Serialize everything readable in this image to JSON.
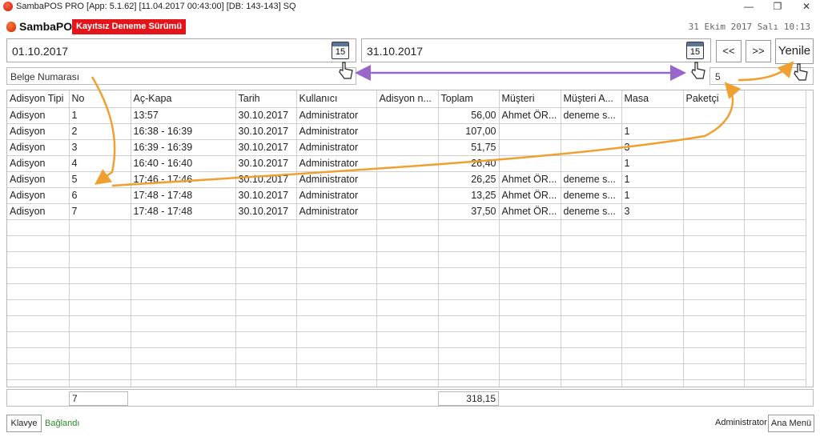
{
  "window": {
    "title": "SambaPOS PRO [App: 5.1.62] [11.04.2017 00:43:00] [DB: 143-143] SQ",
    "minimize": "—",
    "restore": "❐",
    "close": "✕"
  },
  "brand": {
    "name": "SambaPOS",
    "badge": "Kayıtsız Deneme Sürümü"
  },
  "clock": "31 Ekim 2017 Salı 10:13",
  "filters": {
    "start_date": "01.10.2017",
    "end_date": "31.10.2017",
    "calendar_day": "15",
    "prev_label": "<<",
    "next_label": ">>",
    "refresh_label": "Yenile",
    "document_number_placeholder": "Belge Numarası",
    "number_value": "5"
  },
  "table": {
    "columns": [
      "Adisyon Tipi",
      "No",
      "Aç-Kapa",
      "Tarih",
      "Kullanıcı",
      "Adisyon n...",
      "Toplam",
      "Müşteri",
      "Müşteri A...",
      "Masa",
      "Paketçi",
      ""
    ],
    "rows": [
      [
        "Adisyon",
        "1",
        "13:57",
        "30.10.2017",
        "Administrator",
        "",
        "56,00",
        "Ahmet ÖR...",
        "deneme s...",
        "",
        "",
        ""
      ],
      [
        "Adisyon",
        "2",
        "16:38 - 16:39",
        "30.10.2017",
        "Administrator",
        "",
        "107,00",
        "",
        "",
        "1",
        "",
        ""
      ],
      [
        "Adisyon",
        "3",
        "16:39 - 16:39",
        "30.10.2017",
        "Administrator",
        "",
        "51,75",
        "",
        "",
        "3",
        "",
        ""
      ],
      [
        "Adisyon",
        "4",
        "16:40 - 16:40",
        "30.10.2017",
        "Administrator",
        "",
        "26,40",
        "",
        "",
        "1",
        "",
        ""
      ],
      [
        "Adisyon",
        "5",
        "17:46 - 17:46",
        "30.10.2017",
        "Administrator",
        "",
        "26,25",
        "Ahmet ÖR...",
        "deneme s...",
        "1",
        "",
        ""
      ],
      [
        "Adisyon",
        "6",
        "17:48 - 17:48",
        "30.10.2017",
        "Administrator",
        "",
        "13,25",
        "Ahmet ÖR...",
        "deneme s...",
        "1",
        "",
        ""
      ],
      [
        "Adisyon",
        "7",
        "17:48 - 17:48",
        "30.10.2017",
        "Administrator",
        "",
        "37,50",
        "Ahmet ÖR...",
        "deneme s...",
        "3",
        "",
        ""
      ]
    ]
  },
  "totals": {
    "count": "7",
    "sum": "318,15"
  },
  "status": {
    "keyboard_label": "Klavye",
    "connection": "Bağlandı",
    "user": "Administrator",
    "main_menu_label": "Ana Menü"
  },
  "colors": {
    "badge": "#e4141b",
    "annotation_arrow": "#f0a030",
    "range_arrow": "#9966cc",
    "connected": "#2a8a2a"
  }
}
